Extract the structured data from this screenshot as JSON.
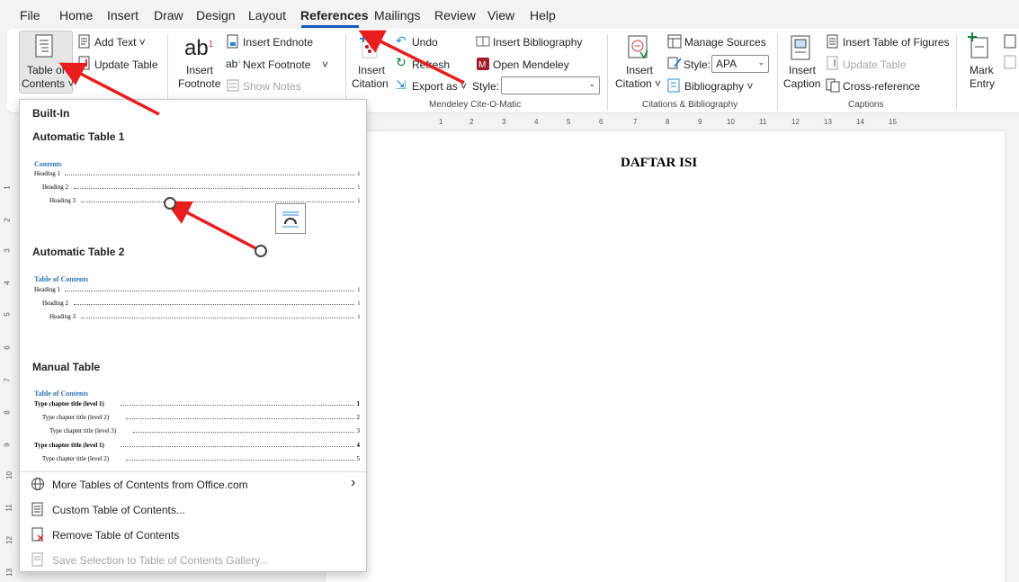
{
  "menu": {
    "tabs": [
      "File",
      "Home",
      "Insert",
      "Draw",
      "Design",
      "Layout",
      "References",
      "Mailings",
      "Review",
      "View",
      "Help"
    ],
    "active_tab": "References"
  },
  "ribbon": {
    "toc": {
      "label_line1": "Table of",
      "label_line2": "Contents ˅",
      "add_text": "Add Text ˅",
      "update_table": "Update Table"
    },
    "footnotes": {
      "insert_footnote_line1": "Insert",
      "insert_footnote_line2": "Footnote",
      "insert_endnote": "Insert Endnote",
      "next_footnote": "Next Footnote",
      "next_footnote_arrow": "˅",
      "show_notes": "Show Notes"
    },
    "mendeley": {
      "insert_citation_line1": "Insert",
      "insert_citation_line2": "Citation",
      "undo": "Undo",
      "refresh": "Refresh",
      "export_as": "Export as ˅",
      "style_label": "Style:",
      "style_value": "",
      "insert_bibliography": "Insert Bibliography",
      "open_mendeley": "Open Mendeley",
      "group_label": "Mendeley Cite-O-Matic"
    },
    "citations": {
      "insert_citation_line1": "Insert",
      "insert_citation_line2": "Citation ˅",
      "manage_sources": "Manage Sources",
      "style_label": "Style:",
      "style_value": "APA",
      "bibliography": "Bibliography ˅",
      "group_label": "Citations & Bibliography"
    },
    "captions": {
      "insert_caption_line1": "Insert",
      "insert_caption_line2": "Caption",
      "insert_table_of_figures": "Insert Table of Figures",
      "update_table": "Update Table",
      "cross_reference": "Cross-reference",
      "group_label": "Captions"
    },
    "index": {
      "mark_entry_line1": "Mark",
      "mark_entry_line2": "Entry"
    }
  },
  "ruler": {
    "h_ticks": [
      "1",
      "2",
      "3",
      "4",
      "5",
      "6",
      "7",
      "8",
      "9",
      "10",
      "11",
      "12",
      "13",
      "14",
      "15"
    ],
    "v_ticks": [
      "1",
      "2",
      "3",
      "4",
      "5",
      "6",
      "7",
      "8",
      "9",
      "10",
      "11",
      "12",
      "13"
    ]
  },
  "document": {
    "title": "DAFTAR ISI"
  },
  "dropdown": {
    "header": "Built-In",
    "auto1": {
      "title": "Automatic Table 1",
      "preview_title": "Contents",
      "lines": [
        {
          "text": "Heading 1",
          "page": "i"
        },
        {
          "text": "Heading 2",
          "page": "i"
        },
        {
          "text": "Heading 3",
          "page": "i"
        }
      ]
    },
    "auto2": {
      "title": "Automatic Table 2",
      "preview_title": "Table of Contents",
      "lines": [
        {
          "text": "Heading 1",
          "page": "i"
        },
        {
          "text": "Heading 2",
          "page": "i"
        },
        {
          "text": "Heading 3",
          "page": "i"
        }
      ]
    },
    "manual": {
      "title": "Manual Table",
      "preview_title": "Table of Contents",
      "lines": [
        {
          "text": "Type chapter title (level 1)",
          "page": "1"
        },
        {
          "text": "Type chapter title (level 2)",
          "page": "2"
        },
        {
          "text": "Type chapter title (level 3)",
          "page": "3"
        },
        {
          "text": "Type chapter title (level 1)",
          "page": "4"
        },
        {
          "text": "Type chapter title (level 2)",
          "page": "5"
        }
      ]
    },
    "commands": {
      "more": "More Tables of Contents from Office.com",
      "more_arrow": "›",
      "custom": "Custom Table of Contents...",
      "remove": "Remove Table of Contents",
      "save_selection": "Save Selection to Table of Contents Gallery..."
    }
  },
  "colors": {
    "accent": "#185abd",
    "annotation_arrow": "#e81e1e",
    "heading_blue": "#2e74b5"
  }
}
